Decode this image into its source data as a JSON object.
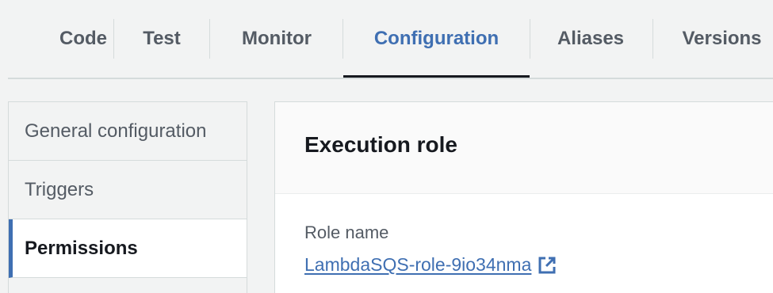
{
  "tabs": [
    {
      "label": "Code",
      "active": false
    },
    {
      "label": "Test",
      "active": false
    },
    {
      "label": "Monitor",
      "active": false
    },
    {
      "label": "Configuration",
      "active": true
    },
    {
      "label": "Aliases",
      "active": false
    },
    {
      "label": "Versions",
      "active": false
    }
  ],
  "sidebar": {
    "items": [
      {
        "label": "General configuration",
        "active": false
      },
      {
        "label": "Triggers",
        "active": false
      },
      {
        "label": "Permissions",
        "active": true
      }
    ]
  },
  "panel": {
    "title": "Execution role",
    "role_name_label": "Role name",
    "role_name_value": "LambdaSQS-role-9io34nma",
    "external_link_icon": "external-link-icon"
  },
  "colors": {
    "accent": "#3f6fb2",
    "text_dark": "#16191f",
    "text_muted": "#545b64",
    "background": "#f2f3f3",
    "border": "#d5dbdb"
  }
}
